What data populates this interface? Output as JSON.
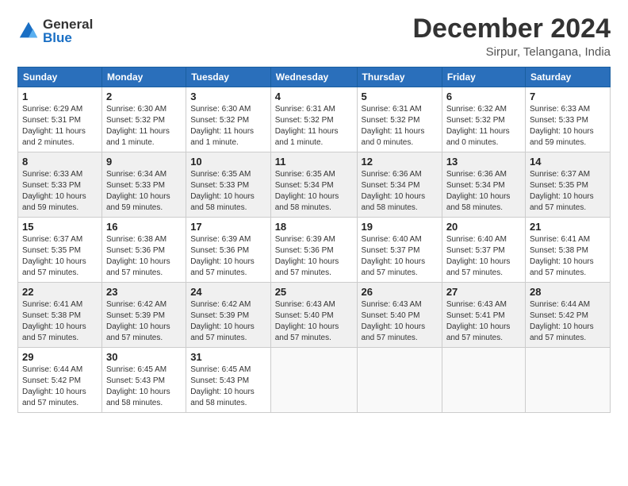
{
  "logo": {
    "general": "General",
    "blue": "Blue"
  },
  "title": "December 2024",
  "subtitle": "Sirpur, Telangana, India",
  "headers": [
    "Sunday",
    "Monday",
    "Tuesday",
    "Wednesday",
    "Thursday",
    "Friday",
    "Saturday"
  ],
  "weeks": [
    [
      {
        "day": "1",
        "info": "Sunrise: 6:29 AM\nSunset: 5:31 PM\nDaylight: 11 hours\nand 2 minutes."
      },
      {
        "day": "2",
        "info": "Sunrise: 6:30 AM\nSunset: 5:32 PM\nDaylight: 11 hours\nand 1 minute."
      },
      {
        "day": "3",
        "info": "Sunrise: 6:30 AM\nSunset: 5:32 PM\nDaylight: 11 hours\nand 1 minute."
      },
      {
        "day": "4",
        "info": "Sunrise: 6:31 AM\nSunset: 5:32 PM\nDaylight: 11 hours\nand 1 minute."
      },
      {
        "day": "5",
        "info": "Sunrise: 6:31 AM\nSunset: 5:32 PM\nDaylight: 11 hours\nand 0 minutes."
      },
      {
        "day": "6",
        "info": "Sunrise: 6:32 AM\nSunset: 5:32 PM\nDaylight: 11 hours\nand 0 minutes."
      },
      {
        "day": "7",
        "info": "Sunrise: 6:33 AM\nSunset: 5:33 PM\nDaylight: 10 hours\nand 59 minutes."
      }
    ],
    [
      {
        "day": "8",
        "info": "Sunrise: 6:33 AM\nSunset: 5:33 PM\nDaylight: 10 hours\nand 59 minutes."
      },
      {
        "day": "9",
        "info": "Sunrise: 6:34 AM\nSunset: 5:33 PM\nDaylight: 10 hours\nand 59 minutes."
      },
      {
        "day": "10",
        "info": "Sunrise: 6:35 AM\nSunset: 5:33 PM\nDaylight: 10 hours\nand 58 minutes."
      },
      {
        "day": "11",
        "info": "Sunrise: 6:35 AM\nSunset: 5:34 PM\nDaylight: 10 hours\nand 58 minutes."
      },
      {
        "day": "12",
        "info": "Sunrise: 6:36 AM\nSunset: 5:34 PM\nDaylight: 10 hours\nand 58 minutes."
      },
      {
        "day": "13",
        "info": "Sunrise: 6:36 AM\nSunset: 5:34 PM\nDaylight: 10 hours\nand 58 minutes."
      },
      {
        "day": "14",
        "info": "Sunrise: 6:37 AM\nSunset: 5:35 PM\nDaylight: 10 hours\nand 57 minutes."
      }
    ],
    [
      {
        "day": "15",
        "info": "Sunrise: 6:37 AM\nSunset: 5:35 PM\nDaylight: 10 hours\nand 57 minutes."
      },
      {
        "day": "16",
        "info": "Sunrise: 6:38 AM\nSunset: 5:36 PM\nDaylight: 10 hours\nand 57 minutes."
      },
      {
        "day": "17",
        "info": "Sunrise: 6:39 AM\nSunset: 5:36 PM\nDaylight: 10 hours\nand 57 minutes."
      },
      {
        "day": "18",
        "info": "Sunrise: 6:39 AM\nSunset: 5:36 PM\nDaylight: 10 hours\nand 57 minutes."
      },
      {
        "day": "19",
        "info": "Sunrise: 6:40 AM\nSunset: 5:37 PM\nDaylight: 10 hours\nand 57 minutes."
      },
      {
        "day": "20",
        "info": "Sunrise: 6:40 AM\nSunset: 5:37 PM\nDaylight: 10 hours\nand 57 minutes."
      },
      {
        "day": "21",
        "info": "Sunrise: 6:41 AM\nSunset: 5:38 PM\nDaylight: 10 hours\nand 57 minutes."
      }
    ],
    [
      {
        "day": "22",
        "info": "Sunrise: 6:41 AM\nSunset: 5:38 PM\nDaylight: 10 hours\nand 57 minutes."
      },
      {
        "day": "23",
        "info": "Sunrise: 6:42 AM\nSunset: 5:39 PM\nDaylight: 10 hours\nand 57 minutes."
      },
      {
        "day": "24",
        "info": "Sunrise: 6:42 AM\nSunset: 5:39 PM\nDaylight: 10 hours\nand 57 minutes."
      },
      {
        "day": "25",
        "info": "Sunrise: 6:43 AM\nSunset: 5:40 PM\nDaylight: 10 hours\nand 57 minutes."
      },
      {
        "day": "26",
        "info": "Sunrise: 6:43 AM\nSunset: 5:40 PM\nDaylight: 10 hours\nand 57 minutes."
      },
      {
        "day": "27",
        "info": "Sunrise: 6:43 AM\nSunset: 5:41 PM\nDaylight: 10 hours\nand 57 minutes."
      },
      {
        "day": "28",
        "info": "Sunrise: 6:44 AM\nSunset: 5:42 PM\nDaylight: 10 hours\nand 57 minutes."
      }
    ],
    [
      {
        "day": "29",
        "info": "Sunrise: 6:44 AM\nSunset: 5:42 PM\nDaylight: 10 hours\nand 57 minutes."
      },
      {
        "day": "30",
        "info": "Sunrise: 6:45 AM\nSunset: 5:43 PM\nDaylight: 10 hours\nand 58 minutes."
      },
      {
        "day": "31",
        "info": "Sunrise: 6:45 AM\nSunset: 5:43 PM\nDaylight: 10 hours\nand 58 minutes."
      },
      {
        "day": "",
        "info": ""
      },
      {
        "day": "",
        "info": ""
      },
      {
        "day": "",
        "info": ""
      },
      {
        "day": "",
        "info": ""
      }
    ]
  ]
}
